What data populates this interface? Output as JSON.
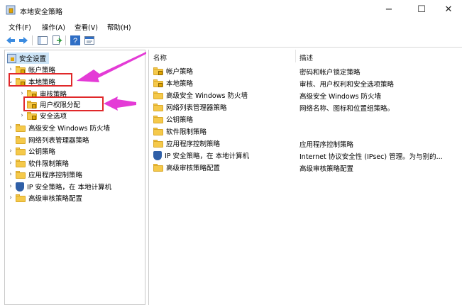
{
  "window": {
    "title": "本地安全策略",
    "minimize_glyph": "−",
    "maximize_glyph": "☐",
    "close_glyph": "✕"
  },
  "menu": [
    "文件(F)",
    "操作(A)",
    "查看(V)",
    "帮助(H)"
  ],
  "toolbar_icons": [
    "back-icon",
    "forward-icon",
    "console-tree-icon",
    "export-list-icon",
    "help-icon",
    "properties-icon"
  ],
  "tree": {
    "root": "安全设置",
    "items": [
      {
        "label": "帐户策略"
      },
      {
        "label": "本地策略"
      },
      {
        "label": "审核策略"
      },
      {
        "label": "用户权限分配"
      },
      {
        "label": "安全选项"
      },
      {
        "label": "高级安全 Windows 防火墙"
      },
      {
        "label": "网络列表管理器策略"
      },
      {
        "label": "公钥策略"
      },
      {
        "label": "软件限制策略"
      },
      {
        "label": "应用程序控制策略"
      },
      {
        "label": "IP 安全策略，在 本地计算机"
      },
      {
        "label": "高级审核策略配置"
      }
    ]
  },
  "list": {
    "columns": {
      "name": "名称",
      "description": "描述"
    },
    "rows": [
      {
        "name": "帐户策略",
        "description": "密码和帐户锁定策略"
      },
      {
        "name": "本地策略",
        "description": "审核、用户权利和安全选项策略"
      },
      {
        "name": "高级安全 Windows 防火墙",
        "description": "高级安全 Windows 防火墙"
      },
      {
        "name": "网络列表管理器策略",
        "description": "网络名称、图标和位置组策略。"
      },
      {
        "name": "公钥策略",
        "description": ""
      },
      {
        "name": "软件限制策略",
        "description": ""
      },
      {
        "name": "应用程序控制策略",
        "description": "应用程序控制策略"
      },
      {
        "name": "IP 安全策略，在 本地计算机",
        "description": "Internet 协议安全性 (IPsec) 管理。为与别的..."
      },
      {
        "name": "高级审核策略配置",
        "description": "高级审核策略配置"
      }
    ]
  },
  "colors": {
    "highlight_box": "#e0282a",
    "arrow": "#e43bd6",
    "folder": "#f5c94a"
  }
}
